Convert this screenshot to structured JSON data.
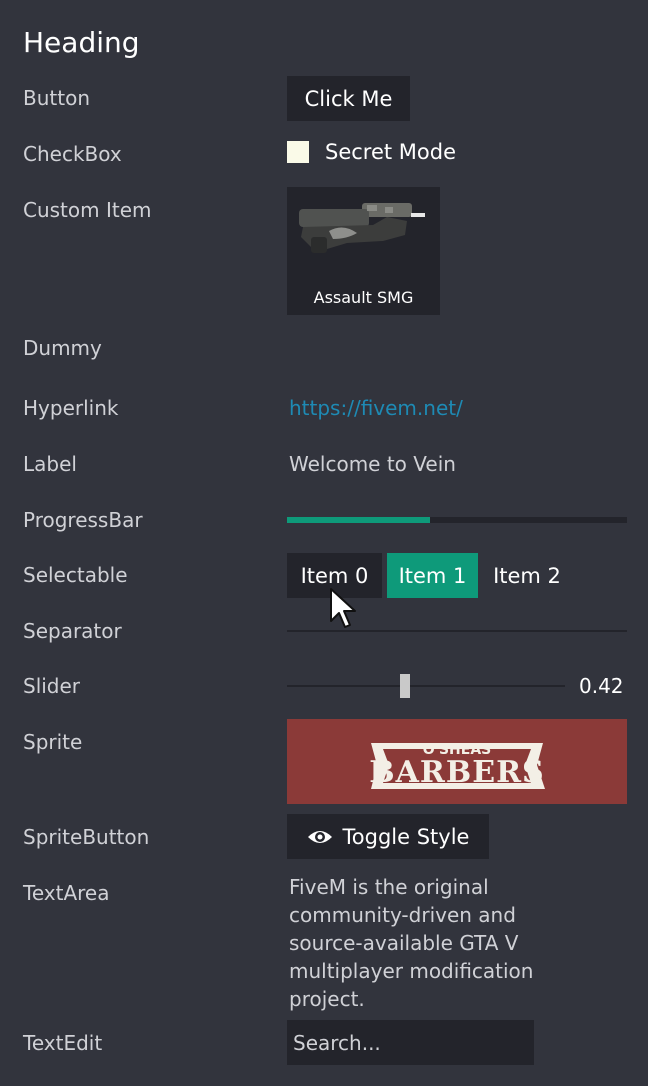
{
  "heading": "Heading",
  "rows": {
    "button": {
      "label": "Button",
      "button_text": "Click Me"
    },
    "checkbox": {
      "label": "CheckBox",
      "text": "Secret Mode",
      "checked": false
    },
    "custom_item": {
      "label": "Custom Item",
      "caption": "Assault SMG",
      "icon": "smg-icon"
    },
    "dummy": {
      "label": "Dummy"
    },
    "hyperlink": {
      "label": "Hyperlink",
      "url": "https://fivem.net/"
    },
    "label": {
      "label": "Label",
      "value": "Welcome to Vein"
    },
    "progressbar": {
      "label": "ProgressBar",
      "progress": 0.42
    },
    "selectable": {
      "label": "Selectable",
      "items": [
        "Item 0",
        "Item 1",
        "Item 2"
      ],
      "selected_index": 1
    },
    "separator": {
      "label": "Separator"
    },
    "slider": {
      "label": "Slider",
      "value": "0.42"
    },
    "sprite": {
      "label": "Sprite",
      "sign_top": "O'SHEAS",
      "sign_main": "BARBERS"
    },
    "spritebutton": {
      "label": "SpriteButton",
      "button_text": "Toggle Style",
      "icon": "eye-icon"
    },
    "textarea": {
      "label": "TextArea",
      "text": "FiveM is the original community-driven and source-available GTA V multiplayer modification project."
    },
    "textedit": {
      "label": "TextEdit",
      "placeholder": "Search..."
    }
  },
  "colors": {
    "background": "#32343d",
    "widget": "#23242b",
    "accent": "#0e9a7a",
    "link": "#1e8ab4",
    "sprite_bg": "#8b3a38"
  }
}
